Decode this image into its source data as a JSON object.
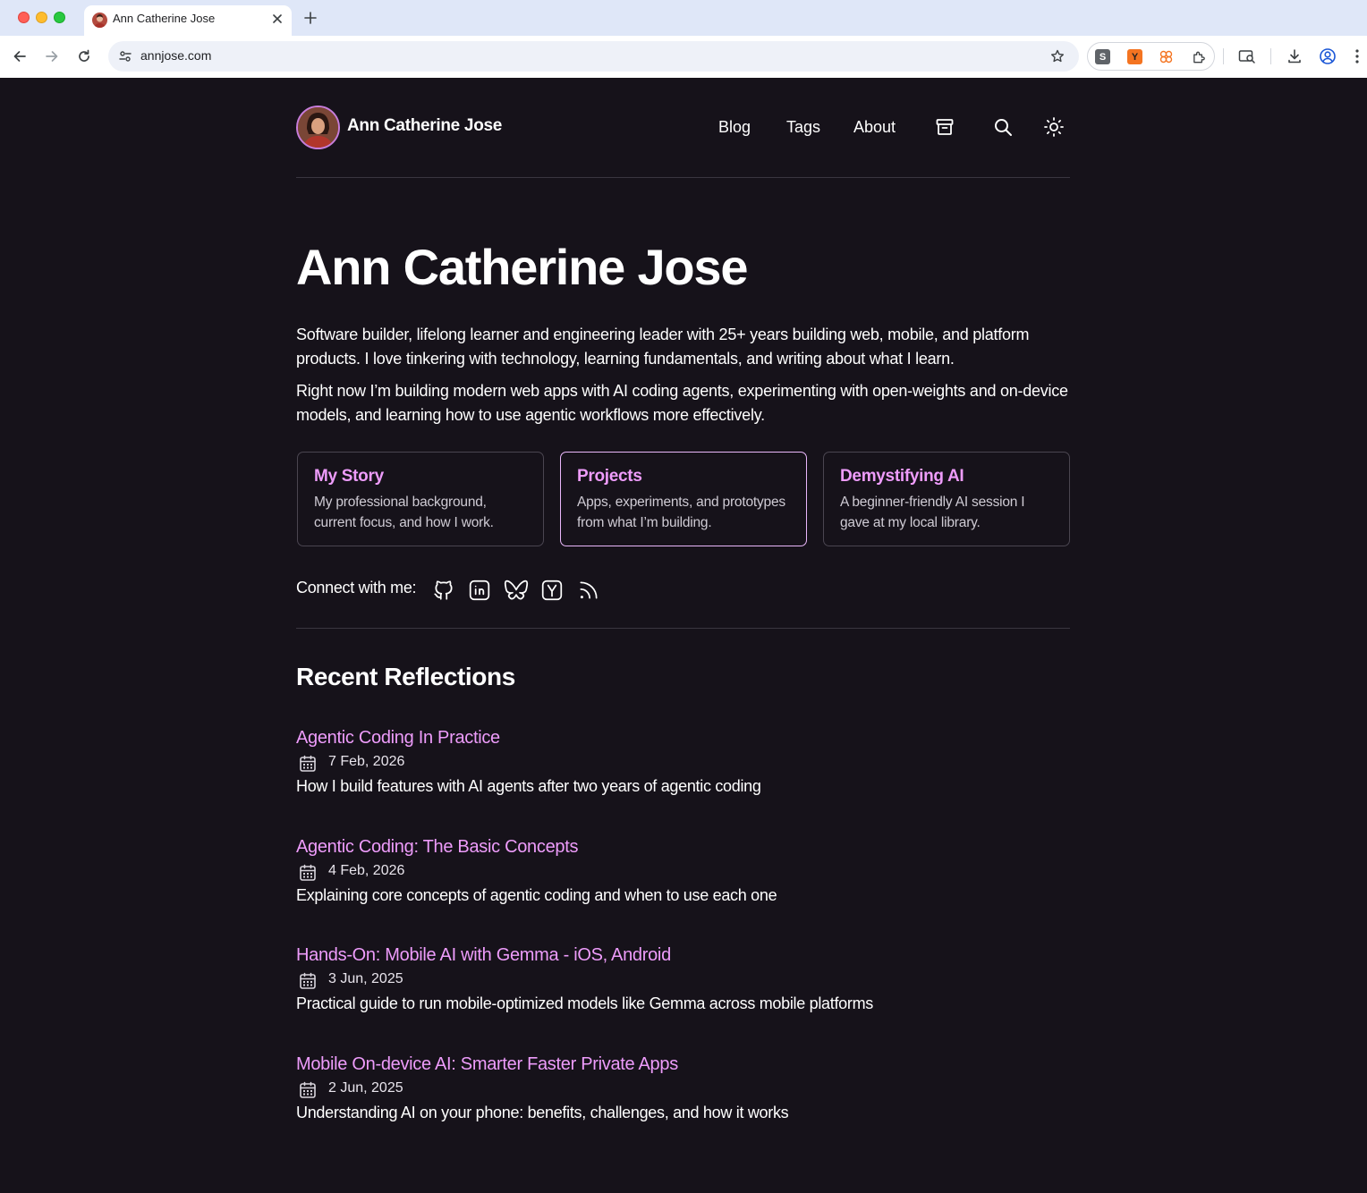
{
  "browser": {
    "tab_title": "Ann Catherine Jose",
    "url": "annjose.com"
  },
  "header": {
    "site_name": "Ann Catherine Jose",
    "nav": [
      {
        "label": "Blog"
      },
      {
        "label": "Tags"
      },
      {
        "label": "About"
      }
    ],
    "icons": [
      "archive-icon",
      "search-icon",
      "sun-theme-icon"
    ]
  },
  "hero": {
    "title": "Ann Catherine Jose",
    "intro_1": "Software builder, lifelong learner and engineering leader with 25+ years building web, mobile, and platform products. I love tinkering with technology, learning fundamentals, and writing about what I learn.",
    "intro_2": "Right now I’m building modern web apps with AI coding agents, experimenting with open-weights and on-device models, and learning how to use agentic workflows more effectively."
  },
  "cards": [
    {
      "title": "My Story",
      "desc": "My professional background, current focus, and how I work."
    },
    {
      "title": "Projects",
      "desc": "Apps, experiments, and prototypes from what I’m building."
    },
    {
      "title": "Demystifying AI",
      "desc": "A beginner-friendly AI session I gave at my local library."
    }
  ],
  "connect": {
    "label": "Connect with me:",
    "icons": [
      "github-icon",
      "linkedin-icon",
      "bluesky-icon",
      "hackernews-icon",
      "rss-icon"
    ]
  },
  "recent": {
    "title": "Recent Reflections",
    "posts": [
      {
        "title": "Agentic Coding In Practice",
        "date": "7 Feb, 2026",
        "desc": "How I build features with AI agents after two years of agentic coding"
      },
      {
        "title": "Agentic Coding: The Basic Concepts",
        "date": "4 Feb, 2026",
        "desc": "Explaining core concepts of agentic coding and when to use each one"
      },
      {
        "title": "Hands-On: Mobile AI with Gemma - iOS, Android",
        "date": "3 Jun, 2025",
        "desc": "Practical guide to run mobile-optimized models like Gemma across mobile platforms"
      },
      {
        "title": "Mobile On-device AI: Smarter Faster Private Apps",
        "date": "2 Jun, 2025",
        "desc": "Understanding AI on your phone: benefits, challenges, and how it works"
      }
    ]
  },
  "colors": {
    "background": "#16121a",
    "accent": "#ee9cfb",
    "card_border": "#4a4550",
    "active_card_border": "#e9b7fa"
  }
}
